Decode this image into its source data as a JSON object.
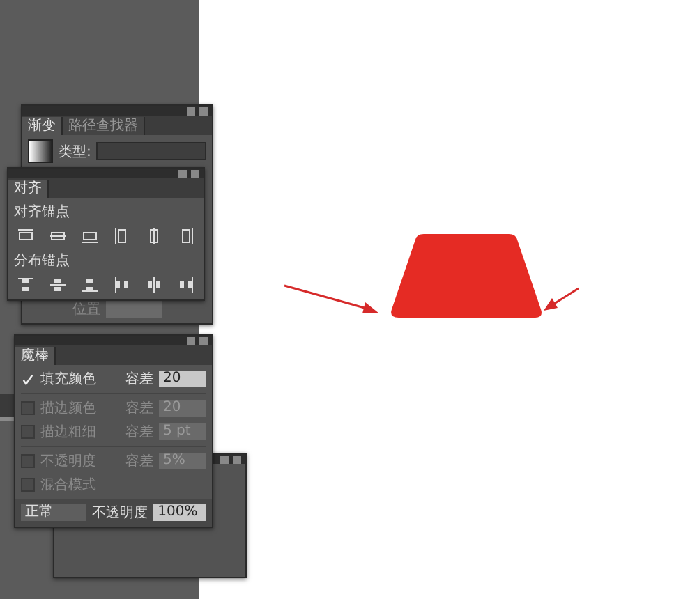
{
  "gradient_panel": {
    "tabs": [
      {
        "label": "渐变",
        "selected": true
      },
      {
        "label": "路径查找器",
        "selected": false
      }
    ],
    "type_label": "类型:",
    "position_label": "位置"
  },
  "align_panel": {
    "tab": "对齐",
    "sections": [
      {
        "label": "对齐锚点",
        "kind": "align"
      },
      {
        "label": "分布锚点",
        "kind": "distribute"
      }
    ]
  },
  "magic_wand_panel": {
    "tab": "魔棒",
    "options": [
      {
        "label": "填充颜色",
        "checked": true,
        "tolerance_label": "容差",
        "tolerance": "20"
      },
      {
        "label": "描边颜色",
        "checked": false,
        "tolerance_label": "容差",
        "tolerance": "20"
      },
      {
        "label": "描边粗细",
        "checked": false,
        "tolerance_label": "容差",
        "tolerance": "5 pt"
      },
      {
        "label": "不透明度",
        "checked": false,
        "tolerance_label": "容差",
        "tolerance": "5%"
      },
      {
        "label": "混合模式",
        "checked": false
      }
    ],
    "blend_mode": "正常",
    "opacity_label": "不透明度",
    "opacity": "100%"
  }
}
